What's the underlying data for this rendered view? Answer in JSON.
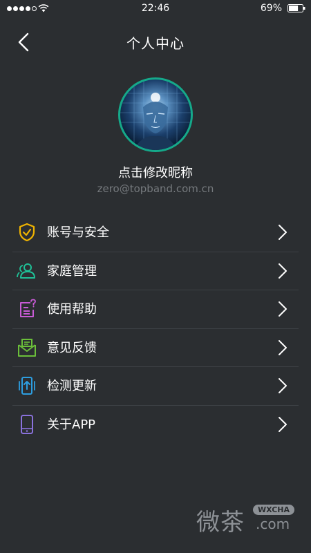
{
  "status_bar": {
    "time": "22:46",
    "battery_percent": "69%",
    "signal_bars_filled": 4,
    "signal_bars_total": 5,
    "battery_level": 0.69
  },
  "header": {
    "title": "个人中心"
  },
  "profile": {
    "nickname": "点击修改昵称",
    "email": "zero@topband.com.cn"
  },
  "menu": [
    {
      "label": "账号与安全",
      "icon": "shield-check-icon",
      "color": "#f0b400"
    },
    {
      "label": "家庭管理",
      "icon": "users-icon",
      "color": "#1fc197"
    },
    {
      "label": "使用帮助",
      "icon": "help-document-icon",
      "color": "#c95bd6"
    },
    {
      "label": "意见反馈",
      "icon": "feedback-mail-icon",
      "color": "#6bbf3a"
    },
    {
      "label": "检测更新",
      "icon": "update-phone-icon",
      "color": "#2d9ee0"
    },
    {
      "label": "关于APP",
      "icon": "phone-icon",
      "color": "#8a72dc"
    }
  ],
  "watermark": {
    "chars": "微茶",
    "badge": "WXCHA",
    "domain": ".com"
  },
  "colors": {
    "background": "#2b2e31",
    "avatar_ring": "#15a98a",
    "secondary_text": "#75797d",
    "divider": "#3d4145"
  }
}
